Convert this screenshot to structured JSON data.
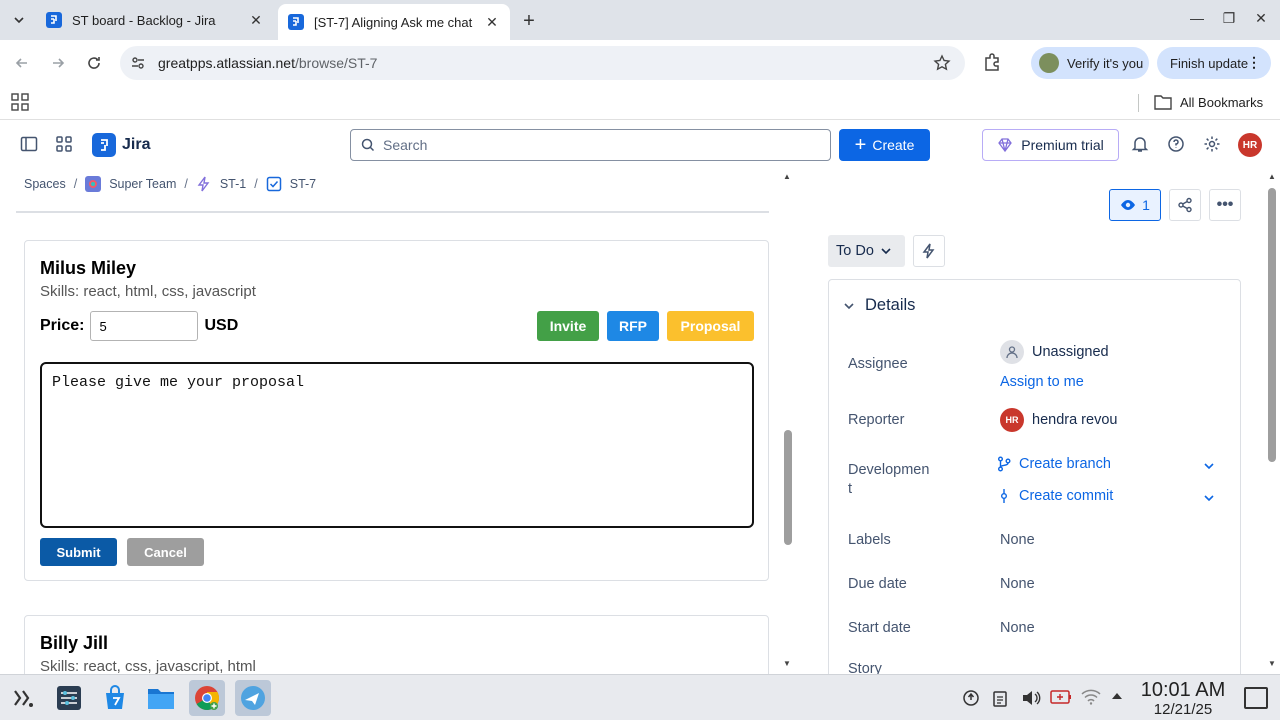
{
  "browser": {
    "tabs": [
      {
        "title": "ST board - Backlog - Jira",
        "active": false
      },
      {
        "title": "[ST-7] Aligning Ask me chat",
        "active": true
      }
    ],
    "url_host": "greatpps.atlassian.net",
    "url_path": "/browse/ST-7",
    "verify_label": "Verify it's you",
    "finish_update_label": "Finish update",
    "all_bookmarks_label": "All Bookmarks"
  },
  "jira_nav": {
    "app_name": "Jira",
    "search_placeholder": "Search",
    "create_label": "Create",
    "premium_label": "Premium trial",
    "avatar_initials": "HR"
  },
  "breadcrumb": {
    "items": [
      "Spaces",
      "Super Team",
      "ST-1",
      "ST-7"
    ]
  },
  "freelancers": [
    {
      "name": "Milus Miley",
      "skills": "Skills: react, html, css, javascript",
      "price_label": "Price:",
      "price_value": "5",
      "currency": "USD",
      "buttons": {
        "invite": "Invite",
        "rfp": "RFP",
        "proposal": "Proposal"
      },
      "message": "Please give me your proposal",
      "submit": "Submit",
      "cancel": "Cancel"
    },
    {
      "name": "Billy Jill",
      "skills": "Skills: react, css, javascript, html"
    }
  ],
  "issue_panel": {
    "watch_count": "1",
    "status": "To Do",
    "details_title": "Details",
    "fields": {
      "assignee_label": "Assignee",
      "assignee_value": "Unassigned",
      "assign_to_me": "Assign to me",
      "reporter_label": "Reporter",
      "reporter_initials": "HR",
      "reporter_value": "hendra revou",
      "development_label_1": "Developmen",
      "development_label_2": "t",
      "create_branch": "Create branch",
      "create_commit": "Create commit",
      "labels_label": "Labels",
      "labels_value": "None",
      "due_date_label": "Due date",
      "due_date_value": "None",
      "start_date_label": "Start date",
      "start_date_value": "None",
      "story_label": "Story"
    }
  },
  "taskbar": {
    "time": "10:01 AM",
    "date": "12/21/25"
  },
  "colors": {
    "jira_blue": "#0c66e4",
    "invite_green": "#43a047",
    "rfp_blue": "#1e88e5",
    "proposal_yellow": "#fbc02d",
    "submit_blue": "#0b5aa6",
    "cancel_gray": "#9e9e9e",
    "avatar_red": "#c9372c"
  }
}
